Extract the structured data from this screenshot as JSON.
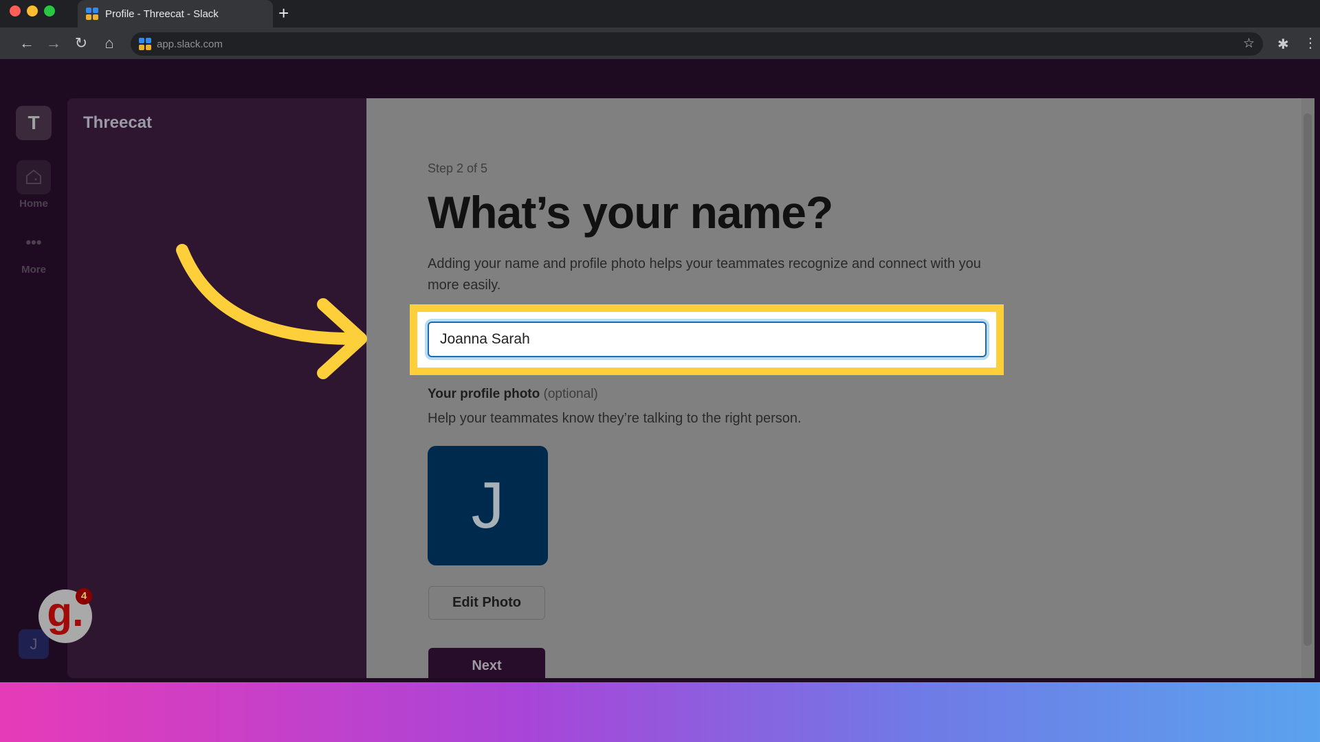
{
  "browser": {
    "tab_title": "Profile - Threecat - Slack",
    "url": "app.slack.com",
    "new_tab": "+"
  },
  "colors": {
    "highlight": "#fdd03b",
    "avatar": "#002a4d",
    "primary_button": "#270d29"
  },
  "rail": {
    "workspace_initial": "T",
    "home_label": "Home",
    "more_label": "More",
    "user_initial": "J"
  },
  "sidebar": {
    "workspace_name": "Threecat"
  },
  "main": {
    "step": "Step 2 of 5",
    "title": "What’s your name?",
    "description": "Adding your name and profile photo helps your teammates recognize and connect with you more easily.",
    "name_value": "Joanna Sarah",
    "photo_label": "Your profile photo",
    "photo_optional": "(optional)",
    "photo_help": "Help your teammates know they’re talking to the right person.",
    "avatar_initial": "J",
    "edit_photo": "Edit Photo",
    "next": "Next"
  },
  "overlay": {
    "badge_letter": "g.",
    "badge_count": "4"
  }
}
